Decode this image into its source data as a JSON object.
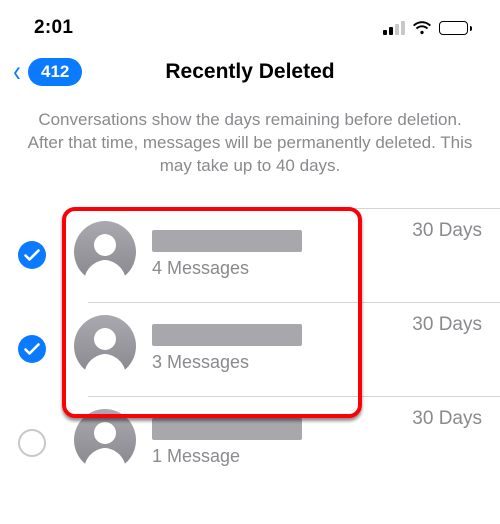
{
  "status": {
    "time": "2:01"
  },
  "nav": {
    "back_count": "412",
    "title": "Recently Deleted"
  },
  "desc": "Conversations show the days remaining before deletion. After that time, messages will be permanently deleted. This may take up to 40 days.",
  "rows": [
    {
      "checked": true,
      "subtitle": "4 Messages",
      "days": "30 Days"
    },
    {
      "checked": true,
      "subtitle": "3 Messages",
      "days": "30 Days"
    },
    {
      "checked": false,
      "subtitle": "1 Message",
      "days": "30 Days"
    }
  ]
}
